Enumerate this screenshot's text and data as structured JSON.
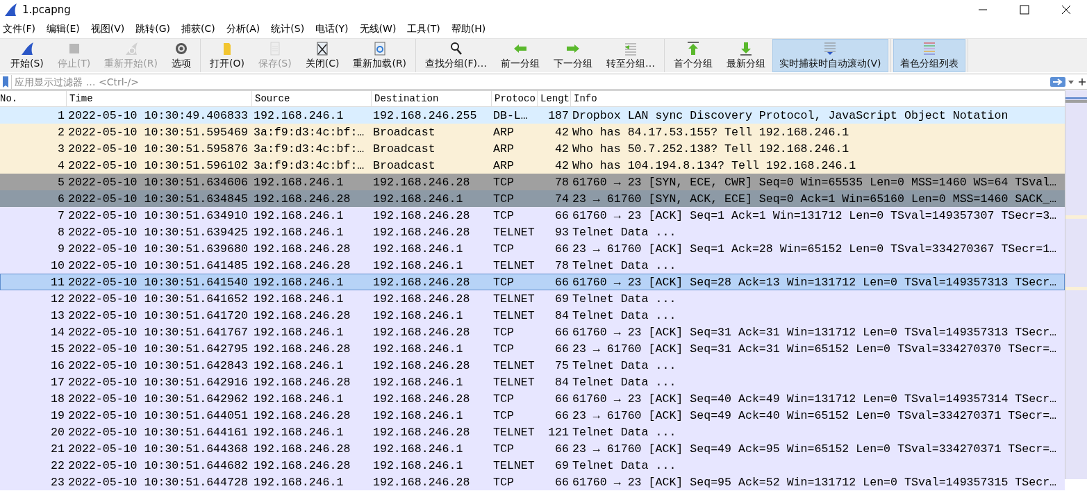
{
  "window": {
    "title": "1.pcapng"
  },
  "menu": [
    "文件(F)",
    "编辑(E)",
    "视图(V)",
    "跳转(G)",
    "捕获(C)",
    "分析(A)",
    "统计(S)",
    "电话(Y)",
    "无线(W)",
    "工具(T)",
    "帮助(H)"
  ],
  "toolbar_groups": [
    {
      "buttons": [
        {
          "label": "开始(S)",
          "disabled": false,
          "on": false
        },
        {
          "label": "停止(T)",
          "disabled": true,
          "on": false
        },
        {
          "label": "重新开始(R)",
          "disabled": true,
          "on": false
        },
        {
          "label": "选项",
          "disabled": false,
          "on": false
        }
      ]
    },
    {
      "buttons": [
        {
          "label": "打开(O)",
          "disabled": false,
          "on": false
        },
        {
          "label": "保存(S)",
          "disabled": true,
          "on": false
        },
        {
          "label": "关闭(C)",
          "disabled": false,
          "on": false
        },
        {
          "label": "重新加载(R)",
          "disabled": false,
          "on": false
        }
      ]
    },
    {
      "buttons": [
        {
          "label": "查找分组(F)…",
          "disabled": false,
          "on": false
        },
        {
          "label": "前一分组",
          "disabled": false,
          "on": false
        },
        {
          "label": "下一分组",
          "disabled": false,
          "on": false
        },
        {
          "label": "转至分组…",
          "disabled": false,
          "on": false
        }
      ]
    },
    {
      "buttons": [
        {
          "label": "首个分组",
          "disabled": false,
          "on": false
        },
        {
          "label": "最新分组",
          "disabled": false,
          "on": false
        },
        {
          "label": "实时捕获时自动滚动(V)",
          "disabled": false,
          "on": true
        }
      ]
    },
    {
      "buttons": [
        {
          "label": "着色分组列表",
          "disabled": false,
          "on": true
        }
      ]
    }
  ],
  "filter": {
    "placeholder": "应用显示过滤器 … <Ctrl-/>"
  },
  "table": {
    "columns": [
      "No.",
      "Time",
      "Source",
      "Destination",
      "Protoco",
      "Lengt",
      "Info"
    ],
    "rows": [
      {
        "cells": [
          "1",
          "2022-05-10 10:30:49.406833",
          "192.168.246.1",
          "192.168.246.255",
          "DB-L…",
          "187",
          "Dropbox LAN sync Discovery Protocol, JavaScript Object Notation"
        ],
        "color": "#daeeff",
        "selected": false
      },
      {
        "cells": [
          "2",
          "2022-05-10 10:30:51.595469",
          "3a:f9:d3:4c:bf:…",
          "Broadcast",
          "ARP",
          "42",
          "Who has 84.17.53.155? Tell 192.168.246.1"
        ],
        "color": "#faf0d7",
        "selected": false
      },
      {
        "cells": [
          "3",
          "2022-05-10 10:30:51.595876",
          "3a:f9:d3:4c:bf:…",
          "Broadcast",
          "ARP",
          "42",
          "Who has 50.7.252.138? Tell 192.168.246.1"
        ],
        "color": "#faf0d7",
        "selected": false
      },
      {
        "cells": [
          "4",
          "2022-05-10 10:30:51.596102",
          "3a:f9:d3:4c:bf:…",
          "Broadcast",
          "ARP",
          "42",
          "Who has 104.194.8.134? Tell 192.168.246.1"
        ],
        "color": "#faf0d7",
        "selected": false
      },
      {
        "cells": [
          "5",
          "2022-05-10 10:30:51.634606",
          "192.168.246.1",
          "192.168.246.28",
          "TCP",
          "78",
          "61760 → 23 [SYN, ECE, CWR] Seq=0 Win=65535 Len=0 MSS=1460 WS=64 TSval…"
        ],
        "color": "#a0a0a0",
        "selected": false
      },
      {
        "cells": [
          "6",
          "2022-05-10 10:30:51.634845",
          "192.168.246.28",
          "192.168.246.1",
          "TCP",
          "74",
          "23 → 61760 [SYN, ACK, ECE] Seq=0 Ack=1 Win=65160 Len=0 MSS=1460 SACK_…"
        ],
        "color": "#8d9aa6",
        "selected": false
      },
      {
        "cells": [
          "7",
          "2022-05-10 10:30:51.634910",
          "192.168.246.1",
          "192.168.246.28",
          "TCP",
          "66",
          "61760 → 23 [ACK] Seq=1 Ack=1 Win=131712 Len=0 TSval=149357307 TSecr=3…"
        ],
        "color": "#e7e6ff",
        "selected": false
      },
      {
        "cells": [
          "8",
          "2022-05-10 10:30:51.639425",
          "192.168.246.1",
          "192.168.246.28",
          "TELNET",
          "93",
          "Telnet Data ..."
        ],
        "color": "#e7e6ff",
        "selected": false
      },
      {
        "cells": [
          "9",
          "2022-05-10 10:30:51.639680",
          "192.168.246.28",
          "192.168.246.1",
          "TCP",
          "66",
          "23 → 61760 [ACK] Seq=1 Ack=28 Win=65152 Len=0 TSval=334270367 TSecr=1…"
        ],
        "color": "#e7e6ff",
        "selected": false
      },
      {
        "cells": [
          "10",
          "2022-05-10 10:30:51.641485",
          "192.168.246.28",
          "192.168.246.1",
          "TELNET",
          "78",
          "Telnet Data ..."
        ],
        "color": "#e7e6ff",
        "selected": false
      },
      {
        "cells": [
          "11",
          "2022-05-10 10:30:51.641540",
          "192.168.246.1",
          "192.168.246.28",
          "TCP",
          "66",
          "61760 → 23 [ACK] Seq=28 Ack=13 Win=131712 Len=0 TSval=149357313 TSecr…"
        ],
        "color": "#b7d3f7",
        "selected": true
      },
      {
        "cells": [
          "12",
          "2022-05-10 10:30:51.641652",
          "192.168.246.1",
          "192.168.246.28",
          "TELNET",
          "69",
          "Telnet Data ..."
        ],
        "color": "#e7e6ff",
        "selected": false
      },
      {
        "cells": [
          "13",
          "2022-05-10 10:30:51.641720",
          "192.168.246.28",
          "192.168.246.1",
          "TELNET",
          "84",
          "Telnet Data ..."
        ],
        "color": "#e7e6ff",
        "selected": false
      },
      {
        "cells": [
          "14",
          "2022-05-10 10:30:51.641767",
          "192.168.246.1",
          "192.168.246.28",
          "TCP",
          "66",
          "61760 → 23 [ACK] Seq=31 Ack=31 Win=131712 Len=0 TSval=149357313 TSecr…"
        ],
        "color": "#e7e6ff",
        "selected": false
      },
      {
        "cells": [
          "15",
          "2022-05-10 10:30:51.642795",
          "192.168.246.28",
          "192.168.246.1",
          "TCP",
          "66",
          "23 → 61760 [ACK] Seq=31 Ack=31 Win=65152 Len=0 TSval=334270370 TSecr=…"
        ],
        "color": "#e7e6ff",
        "selected": false
      },
      {
        "cells": [
          "16",
          "2022-05-10 10:30:51.642843",
          "192.168.246.1",
          "192.168.246.28",
          "TELNET",
          "75",
          "Telnet Data ..."
        ],
        "color": "#e7e6ff",
        "selected": false
      },
      {
        "cells": [
          "17",
          "2022-05-10 10:30:51.642916",
          "192.168.246.28",
          "192.168.246.1",
          "TELNET",
          "84",
          "Telnet Data ..."
        ],
        "color": "#e7e6ff",
        "selected": false
      },
      {
        "cells": [
          "18",
          "2022-05-10 10:30:51.642962",
          "192.168.246.1",
          "192.168.246.28",
          "TCP",
          "66",
          "61760 → 23 [ACK] Seq=40 Ack=49 Win=131712 Len=0 TSval=149357314 TSecr…"
        ],
        "color": "#e7e6ff",
        "selected": false
      },
      {
        "cells": [
          "19",
          "2022-05-10 10:30:51.644051",
          "192.168.246.28",
          "192.168.246.1",
          "TCP",
          "66",
          "23 → 61760 [ACK] Seq=49 Ack=40 Win=65152 Len=0 TSval=334270371 TSecr=…"
        ],
        "color": "#e7e6ff",
        "selected": false
      },
      {
        "cells": [
          "20",
          "2022-05-10 10:30:51.644161",
          "192.168.246.1",
          "192.168.246.28",
          "TELNET",
          "121",
          "Telnet Data ..."
        ],
        "color": "#e7e6ff",
        "selected": false
      },
      {
        "cells": [
          "21",
          "2022-05-10 10:30:51.644368",
          "192.168.246.28",
          "192.168.246.1",
          "TCP",
          "66",
          "23 → 61760 [ACK] Seq=49 Ack=95 Win=65152 Len=0 TSval=334270371 TSecr=…"
        ],
        "color": "#e7e6ff",
        "selected": false
      },
      {
        "cells": [
          "22",
          "2022-05-10 10:30:51.644682",
          "192.168.246.28",
          "192.168.246.1",
          "TELNET",
          "69",
          "Telnet Data ..."
        ],
        "color": "#e7e6ff",
        "selected": false
      },
      {
        "cells": [
          "23",
          "2022-05-10 10:30:51.644728",
          "192.168.246.1",
          "192.168.246.28",
          "TCP",
          "66",
          "61760 → 23 [ACK] Seq=95 Ack=52 Win=131712 Len=0 TSval=149357315 TSecr…"
        ],
        "color": "#e7e6ff",
        "selected": false
      }
    ]
  }
}
